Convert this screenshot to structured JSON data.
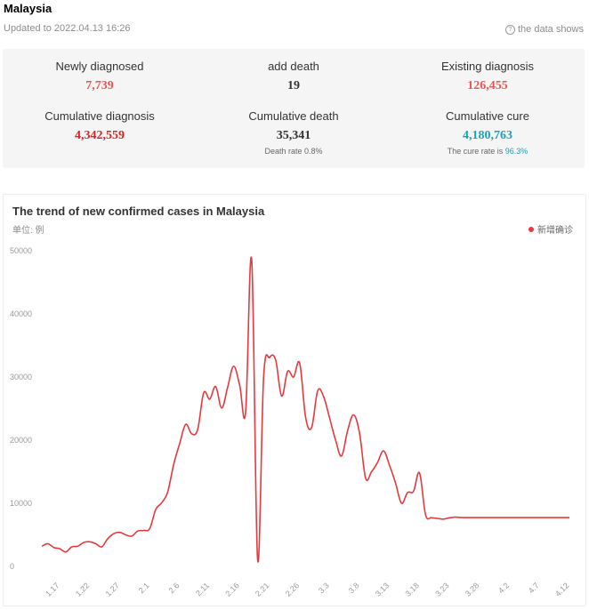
{
  "header": {
    "country": "Malaysia",
    "updated": "Updated to 2022.04.13 16:26",
    "source_label": "the data shows",
    "source_icon": "help-circle-icon"
  },
  "stats": {
    "newly_diagnosed": {
      "label": "Newly diagnosed",
      "value": "7,739",
      "color": "#ef5350"
    },
    "add_death": {
      "label": "add death",
      "value": "19",
      "color": "#333333"
    },
    "existing_diagnosis": {
      "label": "Existing diagnosis",
      "value": "126,455",
      "color": "#ef5350"
    },
    "cumulative_diagnosis": {
      "label": "Cumulative diagnosis",
      "value": "4,342,559",
      "color": "#e02020"
    },
    "cumulative_death": {
      "label": "Cumulative death",
      "value": "35,341",
      "color": "#333333",
      "sub_label": "Death rate ",
      "sub_value": "0.8%"
    },
    "cumulative_cure": {
      "label": "Cumulative cure",
      "value": "4,180,763",
      "color": "#1aa3b8",
      "sub_label": "The cure rate is ",
      "sub_value": "96.3%",
      "sub_color": "#1aa3b8"
    }
  },
  "chart_data": {
    "type": "line",
    "title": "The trend of new confirmed cases in Malaysia",
    "unit": "单位: 例",
    "legend": [
      "新增确诊"
    ],
    "legend_position": "top-right",
    "color": "#e8383d",
    "ylim": [
      0,
      50000
    ],
    "yticks": [
      0,
      10000,
      20000,
      30000,
      40000,
      50000
    ],
    "xticks": [
      "1.17",
      "1.22",
      "1.27",
      "2.1",
      "2.6",
      "2.11",
      "2.16",
      "2.21",
      "2.26",
      "3.3",
      "3.8",
      "3.13",
      "3.18",
      "3.23",
      "3.28",
      "4.2",
      "4.7",
      "4.12"
    ],
    "xtick_index": [
      3,
      8,
      13,
      18,
      23,
      28,
      33,
      38,
      43,
      48,
      53,
      58,
      63,
      68,
      73,
      78,
      83,
      88
    ],
    "grid": false,
    "series": [
      {
        "name": "新增确诊",
        "x": [
          "1.14",
          "1.15",
          "1.16",
          "1.17",
          "1.18",
          "1.19",
          "1.20",
          "1.21",
          "1.22",
          "1.23",
          "1.24",
          "1.25",
          "1.26",
          "1.27",
          "1.28",
          "1.29",
          "1.30",
          "1.31",
          "2.1",
          "2.2",
          "2.3",
          "2.4",
          "2.5",
          "2.6",
          "2.7",
          "2.8",
          "2.9",
          "2.10",
          "2.11",
          "2.12",
          "2.13",
          "2.14",
          "2.15",
          "2.16",
          "2.17",
          "2.18",
          "2.19",
          "2.20",
          "2.21",
          "2.22",
          "2.23",
          "2.24",
          "2.25",
          "2.26",
          "2.27",
          "2.28",
          "3.1",
          "3.2",
          "3.3",
          "3.4",
          "3.5",
          "3.6",
          "3.7",
          "3.8",
          "3.9",
          "3.10",
          "3.11",
          "3.12",
          "3.13",
          "3.14",
          "3.15",
          "3.16",
          "3.17",
          "3.18",
          "3.19",
          "3.20",
          "3.21",
          "3.22",
          "3.23",
          "3.24",
          "3.25",
          "3.26",
          "3.27",
          "3.28",
          "3.29",
          "3.30",
          "3.31",
          "4.1",
          "4.2",
          "4.3",
          "4.4",
          "4.5",
          "4.6",
          "4.7",
          "4.8",
          "4.9",
          "4.10",
          "4.11",
          "4.12"
        ],
        "values": [
          3200,
          3600,
          3000,
          2800,
          2300,
          3100,
          3200,
          3800,
          3900,
          3600,
          3100,
          4400,
          5200,
          5400,
          5000,
          4800,
          5600,
          5700,
          6000,
          9000,
          10100,
          11800,
          16200,
          19500,
          22500,
          21000,
          21700,
          27500,
          26500,
          28500,
          25100,
          28400,
          31700,
          28700,
          24500,
          48500,
          1000,
          30000,
          33100,
          32700,
          27000,
          30900,
          30000,
          32200,
          23600,
          22000,
          27800,
          26900,
          23500,
          20000,
          17500,
          21500,
          24000,
          21100,
          14000,
          15000,
          16500,
          18300,
          16000,
          13200,
          10000,
          11700,
          11900,
          14800,
          8200,
          7739,
          7600,
          7500,
          7700,
          7800,
          7739,
          7739,
          7739,
          7739,
          7739,
          7739,
          7739,
          7739,
          7739,
          7739,
          7739,
          7739,
          7739,
          7739,
          7739,
          7739,
          7739,
          7739,
          7739
        ]
      }
    ]
  }
}
